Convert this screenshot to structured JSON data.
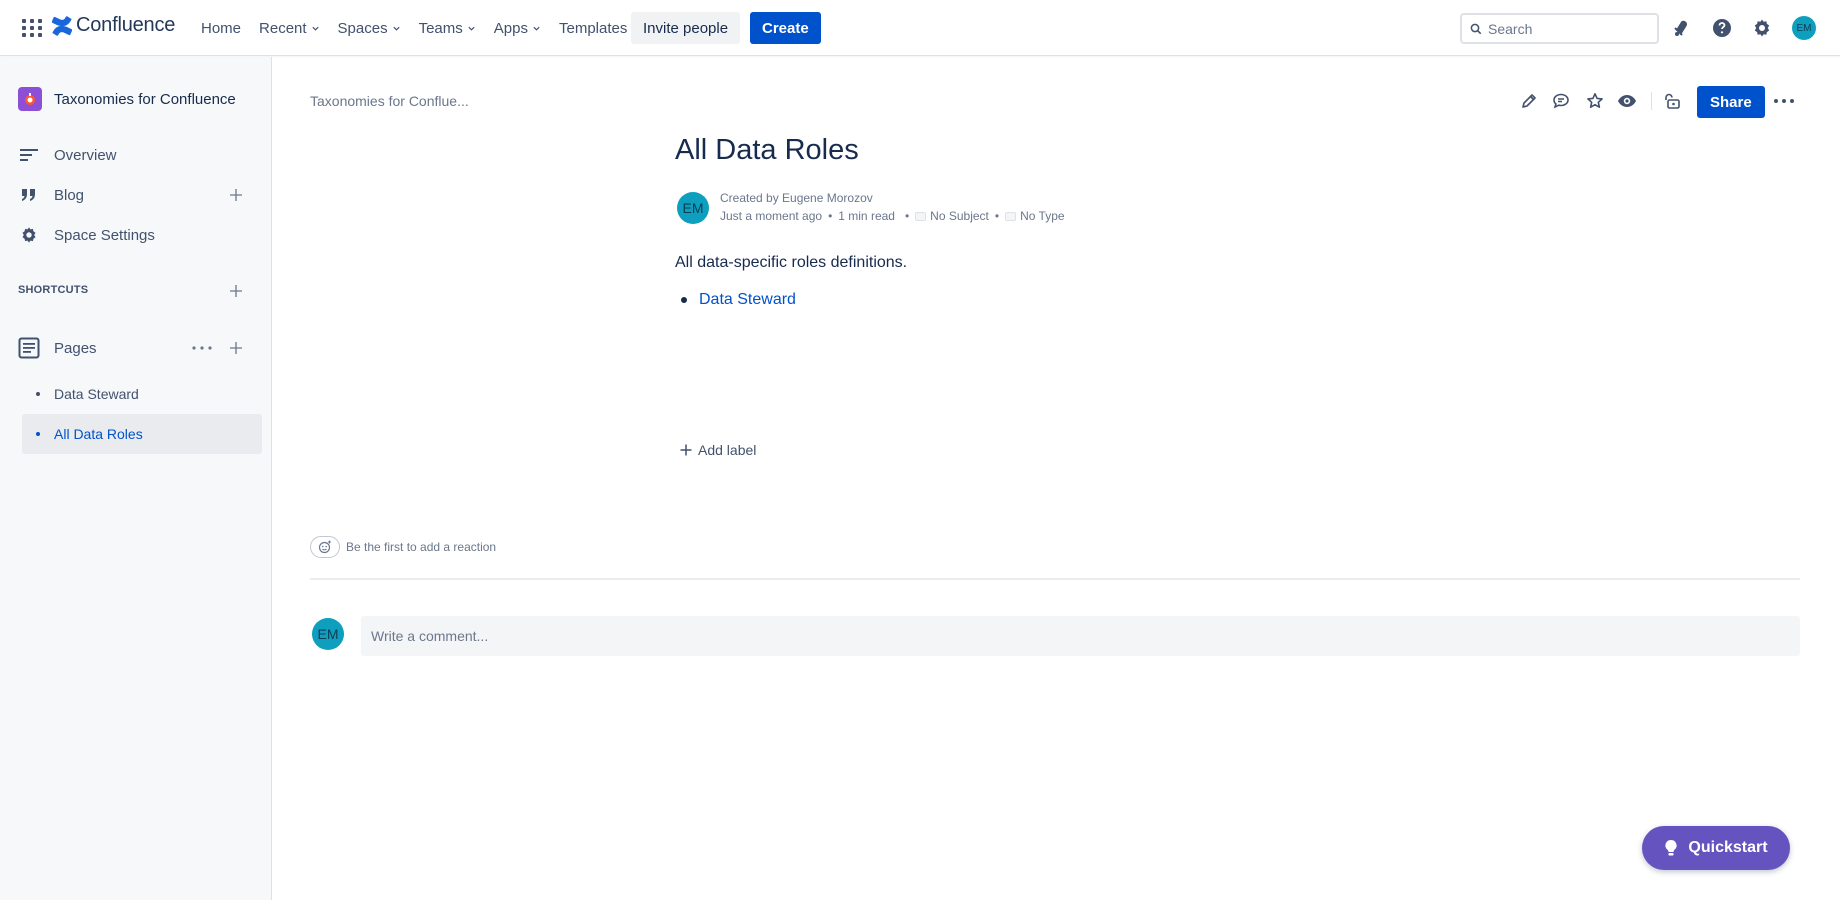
{
  "topnav": {
    "brand": "Confluence",
    "items": [
      {
        "label": "Home",
        "has_menu": false
      },
      {
        "label": "Recent",
        "has_menu": true
      },
      {
        "label": "Spaces",
        "has_menu": true
      },
      {
        "label": "Teams",
        "has_menu": true
      },
      {
        "label": "Apps",
        "has_menu": true
      },
      {
        "label": "Templates",
        "has_menu": false
      }
    ],
    "invite_label": "Invite people",
    "create_label": "Create",
    "search_placeholder": "Search",
    "user_initials": "EM"
  },
  "sidebar": {
    "space_name": "Taxonomies for Confluence",
    "nav": [
      {
        "label": "Overview",
        "icon": "overview-icon"
      },
      {
        "label": "Blog",
        "icon": "quote-icon"
      },
      {
        "label": "Space Settings",
        "icon": "gear-icon"
      }
    ],
    "shortcuts_label": "SHORTCUTS",
    "pages_label": "Pages",
    "pages": [
      {
        "label": "Data Steward",
        "active": false
      },
      {
        "label": "All Data Roles",
        "active": true
      }
    ]
  },
  "page": {
    "breadcrumb": "Taxonomies for Conflue...",
    "share_label": "Share",
    "title": "All Data Roles",
    "author_initials": "EM",
    "created_by": "Created by Eugene Morozov",
    "time_ago": "Just a moment ago",
    "read_time": "1 min read",
    "subject": "No Subject",
    "type": "No Type",
    "body_text": "All data-specific roles definitions.",
    "bullets": [
      "Data Steward"
    ],
    "add_label": "Add label",
    "reaction_text": "Be the first to add a reaction",
    "comment_initials": "EM",
    "comment_placeholder": "Write a comment..."
  },
  "quickstart_label": "Quickstart",
  "colors": {
    "primary": "#0052cc",
    "avatar": "#0e9fbf",
    "quickstart": "#6554c0",
    "sidebar_bg": "#f7f8f9"
  }
}
